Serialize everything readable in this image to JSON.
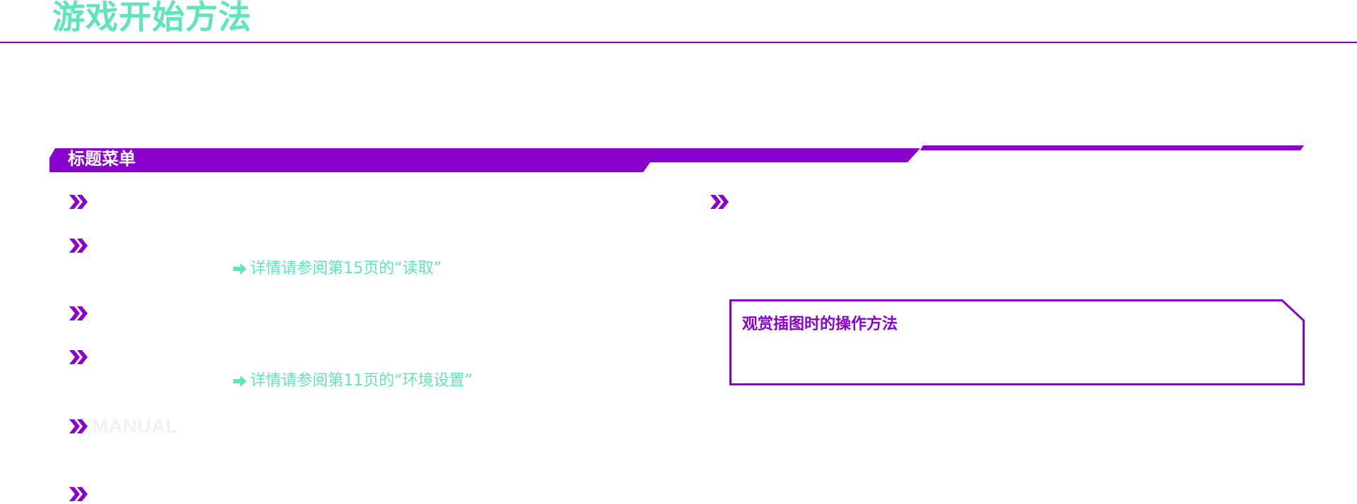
{
  "page": {
    "title": "游戏开始方法"
  },
  "section": {
    "title": "标题菜单"
  },
  "references": [
    {
      "text": "详情请参阅第15页的“读取”"
    },
    {
      "text": "详情请参阅第11页的“环境设置”"
    }
  ],
  "watermark": {
    "text": "MANUAL"
  },
  "info_box": {
    "title": "观赏插图时的操作方法"
  },
  "bullet_icon": "double-chevron-right-icon",
  "reference_icon": "arrow-right-icon",
  "colors": {
    "accent_purple": "#8A00CC",
    "accent_mint": "#5FE5B8",
    "background": "#FFFFFF"
  }
}
